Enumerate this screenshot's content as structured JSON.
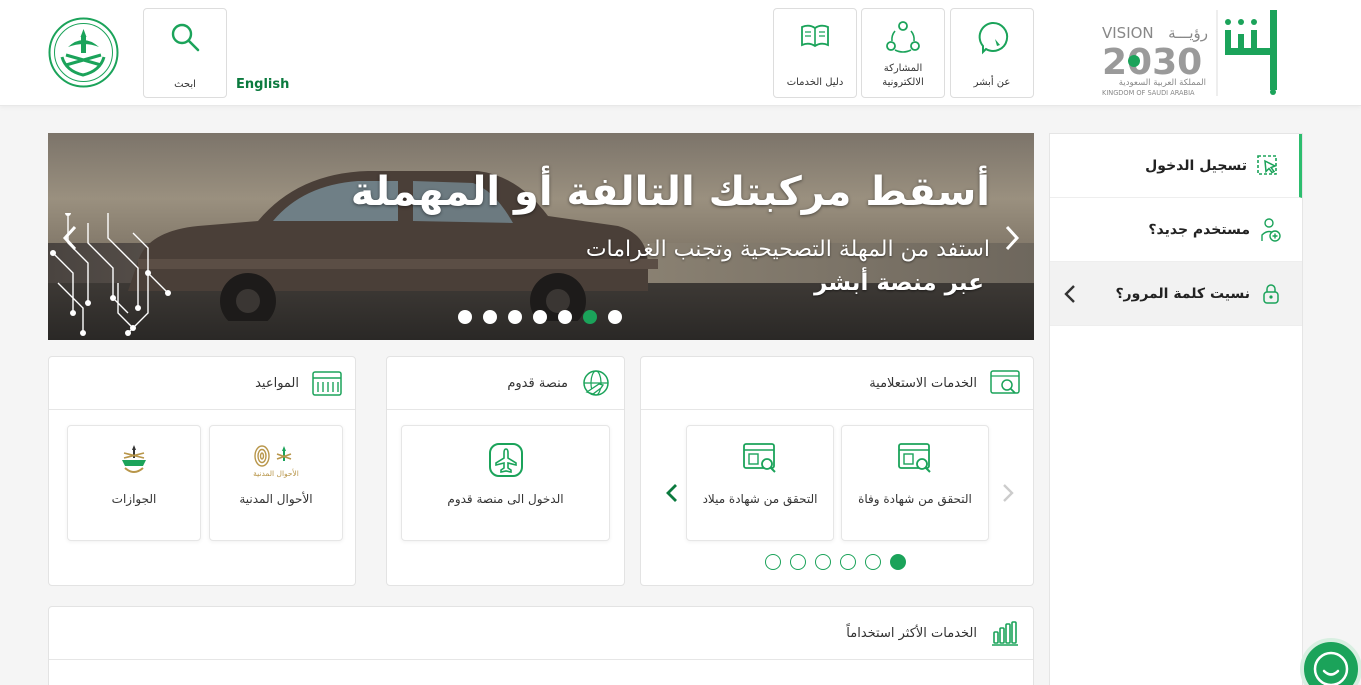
{
  "header": {
    "search_label": "ابحث",
    "english_link": "English",
    "nav": [
      {
        "label": "دليل الخدمات"
      },
      {
        "label": "المشاركة الالكترونية"
      },
      {
        "label": "عن أبشر"
      }
    ],
    "vision": {
      "line1": "VISION",
      "line1_ar": "رؤيـــة",
      "year": "2030",
      "kingdom_ar": "المملكة العربية السعودية",
      "kingdom_en": "KINGDOM OF SAUDI ARABIA"
    }
  },
  "side": {
    "login": "تسجيل الدخول",
    "new_user": "مستخدم جديد؟",
    "forgot": "نسيت كلمة المرور؟"
  },
  "banner": {
    "headline": "أسقط مركبتك التالفة أو المهملة",
    "sub1": "استفد من المهلة التصحيحية وتجنب الغرامات",
    "sub2": "عبر منصة أبشر",
    "dots_total": 7,
    "active_dot": 6
  },
  "inquiry": {
    "title": "الخدمات الاستعلامية",
    "tiles": [
      {
        "label": "التحقق من شهادة وفاة"
      },
      {
        "label": "التحقق من شهادة ميلاد"
      }
    ],
    "dots_total": 6,
    "active_dot": 6
  },
  "qudoom": {
    "title": "منصة قدوم",
    "tiles": [
      {
        "label": "الدخول الى منصة قدوم"
      }
    ]
  },
  "appointments": {
    "title": "المواعيد",
    "tiles": [
      {
        "label": "الأحوال المدنية",
        "logo_text": "الأحوال المدنية"
      },
      {
        "label": "الجوازات"
      }
    ]
  },
  "most_used": {
    "title": "الخدمات الأكثر استخداماً"
  },
  "colors": {
    "brand_green": "#1ba35a",
    "dark_green": "#0b7a3e",
    "gold": "#b8964a"
  }
}
